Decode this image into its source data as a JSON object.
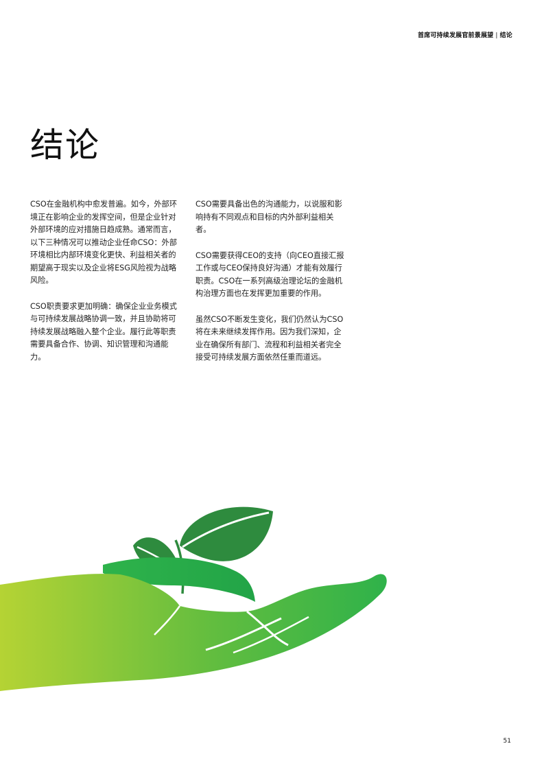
{
  "header": {
    "section": "首席可持续发展官前景展望",
    "separator": "|",
    "chapter": "结论"
  },
  "page_title": "结论",
  "columns": {
    "left": [
      "CSO在金融机构中愈发普遍。如今，外部环境正在影响企业的发挥空间，但是企业针对外部环境的应对措施日趋成熟。通常而言，以下三种情况可以推动企业任命CSO：外部环境相比内部环境变化更快、利益相关者的期望高于现实以及企业将ESG风险视为战略风险。",
      "CSO职责要求更加明确：确保企业业务模式与可持续发展战略协调一致，并且协助将可持续发展战略融入整个企业。履行此等职责需要具备合作、协调、知识管理和沟通能力。"
    ],
    "right": [
      "CSO需要具备出色的沟通能力，以说服和影响持有不同观点和目标的内外部利益相关者。",
      "CSO需要获得CEO的支持（向CEO直接汇报工作或与CEO保持良好沟通）才能有效履行职责。CSO在一系列高级治理论坛的金融机构治理方面也在发挥更加重要的作用。",
      "虽然CSO不断发生变化，我们仍然认为CSO将在未来继续发挥作用。因为我们深知，企业在确保所有部门、流程和利益相关者完全接受可持续发展方面依然任重而道远。"
    ]
  },
  "illustration": {
    "icon": "hand-holding-seedling-icon",
    "colors": {
      "leaf_dark": "#2e8b3e",
      "leaf_light": "#3fae49",
      "hand_left": "#b5d334",
      "hand_right": "#2fb24a"
    }
  },
  "page_number": "51"
}
